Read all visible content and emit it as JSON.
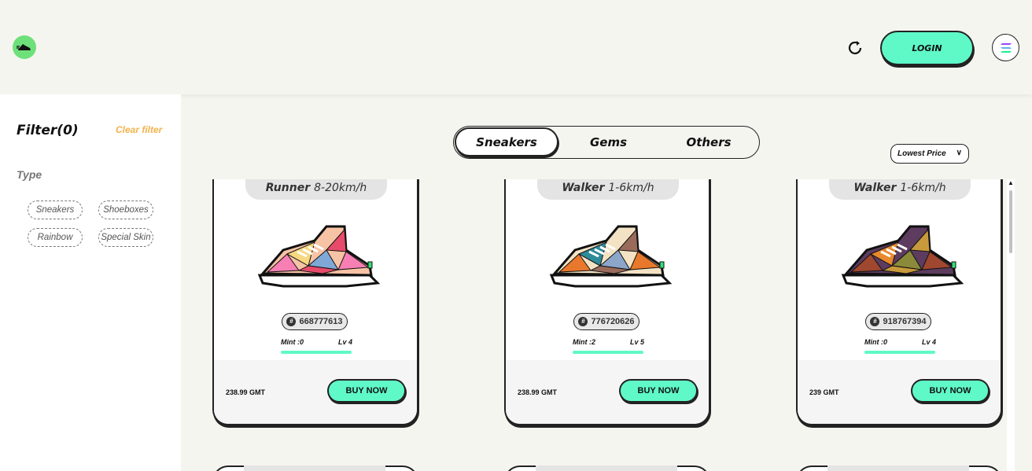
{
  "header": {
    "login_label": "LOGIN"
  },
  "sidebar": {
    "filter_title": "Filter(0)",
    "clear_label": "Clear filter",
    "type_label": "Type",
    "chips": [
      "Sneakers",
      "Shoeboxes",
      "Rainbow",
      "Special Skin"
    ]
  },
  "tabs": [
    "Sneakers",
    "Gems",
    "Others"
  ],
  "sort": {
    "selected": "Lowest Price"
  },
  "cards": [
    {
      "type": "Runner",
      "speed": "8-20km/h",
      "id": "668777613",
      "mint": "Mint :0",
      "level": "Lv 4",
      "price": "238.99 GMT",
      "buy": "BUY NOW",
      "colors": [
        "#f77fb3",
        "#f7d87f",
        "#7fa8d6",
        "#f7c3a5",
        "#e84a6b"
      ]
    },
    {
      "type": "Walker",
      "speed": "1-6km/h",
      "id": "776720626",
      "mint": "Mint :2",
      "level": "Lv 5",
      "price": "238.99 GMT",
      "buy": "BUY NOW",
      "colors": [
        "#e8782c",
        "#2f8a9a",
        "#8ca6c9",
        "#f3e3c4",
        "#9a6b5a"
      ]
    },
    {
      "type": "Walker",
      "speed": "1-6km/h",
      "id": "918767394",
      "mint": "Mint :0",
      "level": "Lv 4",
      "price": "239 GMT",
      "buy": "BUY NOW",
      "colors": [
        "#a0472f",
        "#e8892c",
        "#8a8a3a",
        "#5d3c5f",
        "#c99a3b"
      ]
    }
  ],
  "accent_color": "#5ff9c8"
}
